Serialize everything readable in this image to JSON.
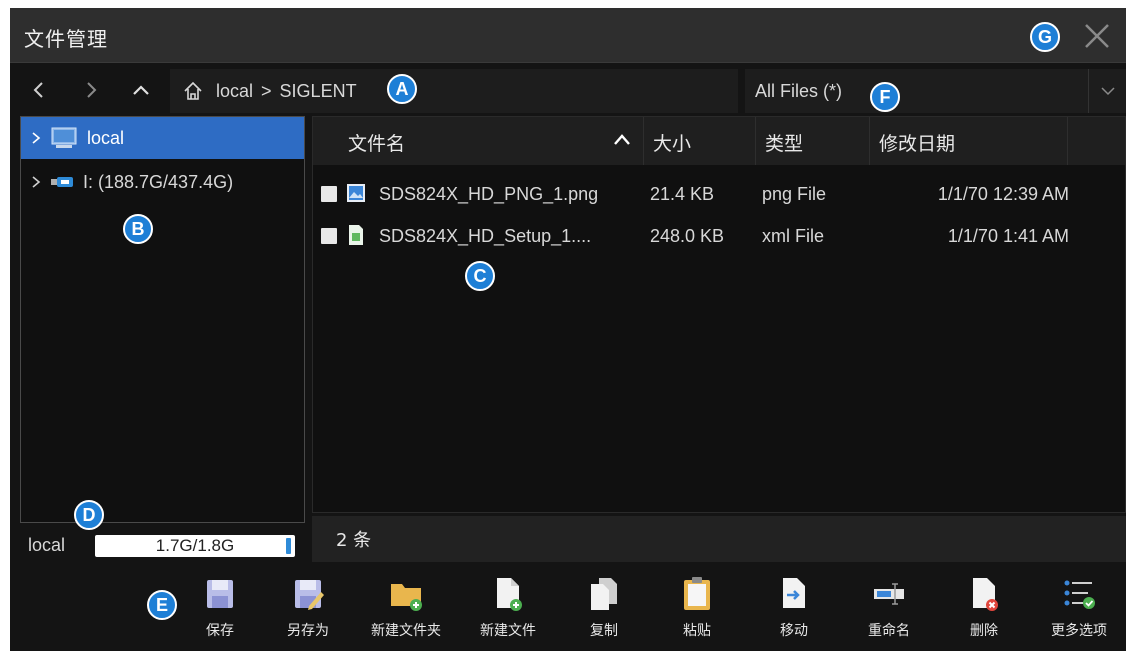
{
  "window": {
    "title": "文件管理",
    "close_icon": "close-icon"
  },
  "nav": {
    "back_icon": "chevron-left-icon",
    "forward_icon": "chevron-right-icon",
    "up_icon": "chevron-up-icon",
    "path": {
      "home_icon": "home-icon",
      "segments": [
        "local",
        "SIGLENT"
      ],
      "separator": ">"
    },
    "filter": {
      "selected": "All Files (*)",
      "dropdown_icon": "chevron-down-icon"
    }
  },
  "tree": {
    "items": [
      {
        "label": "local",
        "icon": "monitor-icon",
        "selected": true
      },
      {
        "label": "I: (188.7G/437.4G)",
        "icon": "usb-drive-icon",
        "selected": false
      }
    ]
  },
  "storage": {
    "label": "local",
    "usage": "1.7G/1.8G",
    "used_fraction": 0.94
  },
  "file_list": {
    "columns": [
      "文件名",
      "大小",
      "类型",
      "修改日期"
    ],
    "sort_icon": "chevron-up-icon",
    "rows": [
      {
        "name": "SDS824X_HD_PNG_1.png",
        "size": "21.4 KB",
        "type": "png File",
        "modified": "1/1/70 12:39 AM",
        "icon": "image-file-icon"
      },
      {
        "name": "SDS824X_HD_Setup_1....",
        "size": "248.0 KB",
        "type": "xml File",
        "modified": "1/1/70 1:41 AM",
        "icon": "xml-file-icon"
      }
    ],
    "count_label": "2 条"
  },
  "toolbar": {
    "items": [
      {
        "label": "保存",
        "icon": "save-icon"
      },
      {
        "label": "另存为",
        "icon": "save-as-icon"
      },
      {
        "label": "新建文件夹",
        "icon": "new-folder-icon"
      },
      {
        "label": "新建文件",
        "icon": "new-file-icon"
      },
      {
        "label": "复制",
        "icon": "copy-icon"
      },
      {
        "label": "粘贴",
        "icon": "paste-icon"
      },
      {
        "label": "移动",
        "icon": "move-icon"
      },
      {
        "label": "重命名",
        "icon": "rename-icon"
      },
      {
        "label": "删除",
        "icon": "delete-icon"
      },
      {
        "label": "更多选项",
        "icon": "more-options-icon"
      }
    ]
  },
  "callouts": [
    "A",
    "B",
    "C",
    "D",
    "E",
    "F",
    "G"
  ],
  "colors": {
    "accent": "#2e6cc4",
    "badge": "#1e7fd6",
    "background": "#141414"
  }
}
